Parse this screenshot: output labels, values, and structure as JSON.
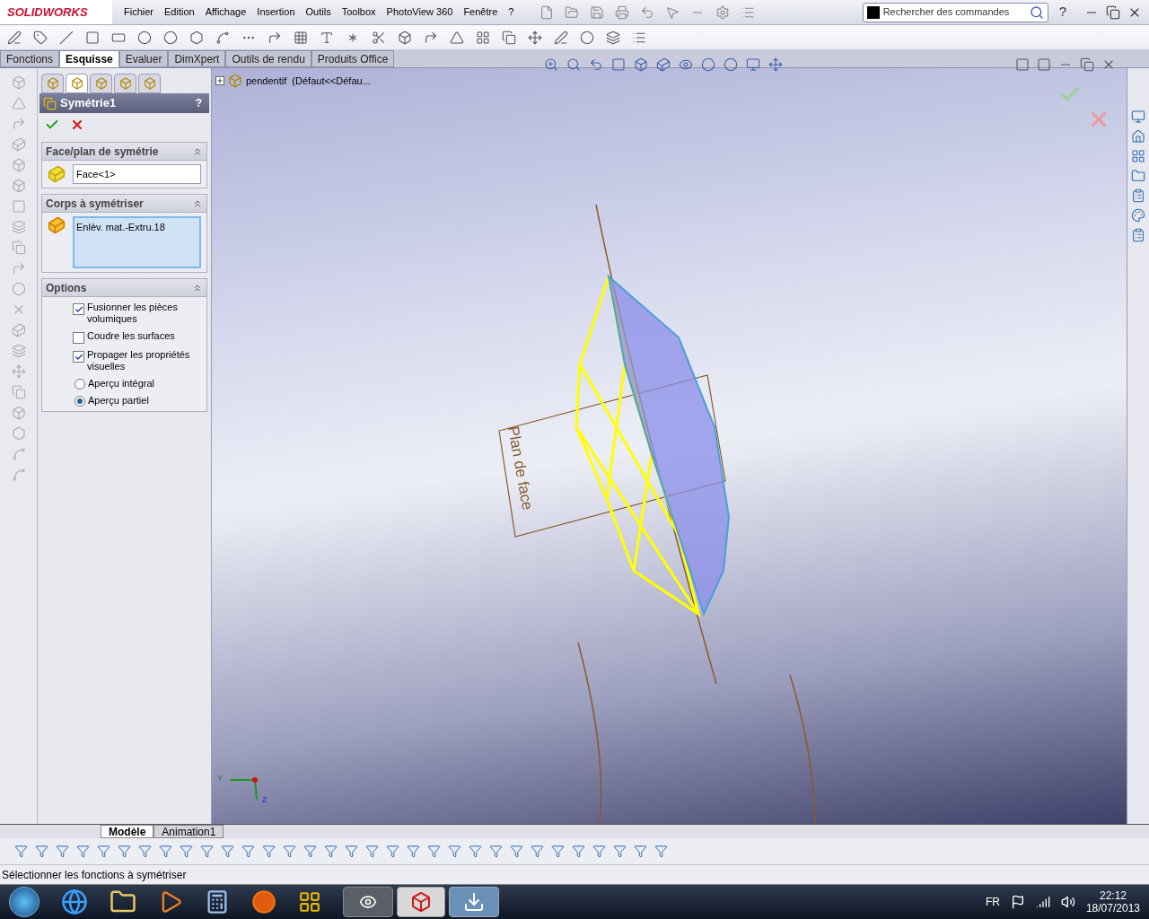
{
  "app": {
    "logo": "SOLIDWORKS"
  },
  "menu": [
    "Fichier",
    "Edition",
    "Affichage",
    "Insertion",
    "Outils",
    "Toolbox",
    "PhotoView 360",
    "Fenêtre",
    "?"
  ],
  "search": {
    "placeholder": "Rechercher des commandes"
  },
  "help": "?",
  "command_tabs": [
    {
      "label": "Fonctions",
      "selected": false
    },
    {
      "label": "Esquisse",
      "selected": true
    },
    {
      "label": "Evaluer",
      "selected": false
    },
    {
      "label": "DimXpert",
      "selected": false
    },
    {
      "label": "Outils de rendu",
      "selected": false
    },
    {
      "label": "Produits Office",
      "selected": false
    }
  ],
  "property_manager": {
    "panel_tabs": [
      {
        "selected": false
      },
      {
        "selected": true
      },
      {
        "selected": false
      },
      {
        "selected": false
      },
      {
        "selected": false
      }
    ],
    "title": "Symétrie1",
    "help": "?",
    "sections": [
      {
        "kind": "field",
        "title": "Face/plan de symétrie",
        "expanded": true,
        "value": "Face<1>"
      },
      {
        "kind": "list",
        "title": "Corps à symétriser",
        "expanded": true,
        "value": "Enlèv. mat.-Extru.18"
      },
      {
        "kind": "options",
        "title": "Options",
        "expanded": true,
        "options": [
          {
            "kind": "checkbox",
            "label": "Fusionner les pièces volumiques",
            "checked": true
          },
          {
            "kind": "checkbox",
            "label": "Coudre les surfaces",
            "checked": false
          },
          {
            "kind": "checkbox",
            "label": "Propager les propriétés visuelles",
            "checked": true
          },
          {
            "kind": "radio",
            "label": "Aperçu intégral",
            "selected": false
          },
          {
            "kind": "radio",
            "label": "Aperçu partiel",
            "selected": true
          }
        ]
      }
    ]
  },
  "viewport": {
    "tree_root": "pendentif  (Défaut<<Défau...",
    "plane_label": "Plan de face",
    "triad": [
      "Y",
      "Z"
    ]
  },
  "model_tabs": [
    {
      "label": "Modèle",
      "selected": true
    },
    {
      "label": "Animation1",
      "selected": false
    }
  ],
  "status_bar": "Sélectionner les fonctions à symétriser",
  "taskbar": {
    "language": "FR",
    "time": "22:12",
    "date": "18/07/2013"
  }
}
